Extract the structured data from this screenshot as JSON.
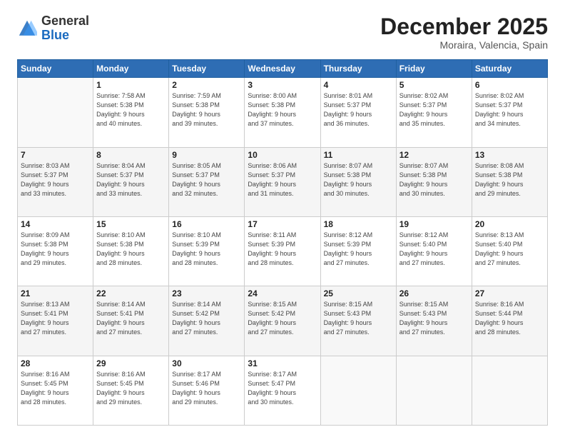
{
  "logo": {
    "general": "General",
    "blue": "Blue"
  },
  "header": {
    "month": "December 2025",
    "location": "Moraira, Valencia, Spain"
  },
  "days_of_week": [
    "Sunday",
    "Monday",
    "Tuesday",
    "Wednesday",
    "Thursday",
    "Friday",
    "Saturday"
  ],
  "weeks": [
    [
      {
        "day": "",
        "info": ""
      },
      {
        "day": "1",
        "info": "Sunrise: 7:58 AM\nSunset: 5:38 PM\nDaylight: 9 hours\nand 40 minutes."
      },
      {
        "day": "2",
        "info": "Sunrise: 7:59 AM\nSunset: 5:38 PM\nDaylight: 9 hours\nand 39 minutes."
      },
      {
        "day": "3",
        "info": "Sunrise: 8:00 AM\nSunset: 5:38 PM\nDaylight: 9 hours\nand 37 minutes."
      },
      {
        "day": "4",
        "info": "Sunrise: 8:01 AM\nSunset: 5:37 PM\nDaylight: 9 hours\nand 36 minutes."
      },
      {
        "day": "5",
        "info": "Sunrise: 8:02 AM\nSunset: 5:37 PM\nDaylight: 9 hours\nand 35 minutes."
      },
      {
        "day": "6",
        "info": "Sunrise: 8:02 AM\nSunset: 5:37 PM\nDaylight: 9 hours\nand 34 minutes."
      }
    ],
    [
      {
        "day": "7",
        "info": "Sunrise: 8:03 AM\nSunset: 5:37 PM\nDaylight: 9 hours\nand 33 minutes."
      },
      {
        "day": "8",
        "info": "Sunrise: 8:04 AM\nSunset: 5:37 PM\nDaylight: 9 hours\nand 33 minutes."
      },
      {
        "day": "9",
        "info": "Sunrise: 8:05 AM\nSunset: 5:37 PM\nDaylight: 9 hours\nand 32 minutes."
      },
      {
        "day": "10",
        "info": "Sunrise: 8:06 AM\nSunset: 5:37 PM\nDaylight: 9 hours\nand 31 minutes."
      },
      {
        "day": "11",
        "info": "Sunrise: 8:07 AM\nSunset: 5:38 PM\nDaylight: 9 hours\nand 30 minutes."
      },
      {
        "day": "12",
        "info": "Sunrise: 8:07 AM\nSunset: 5:38 PM\nDaylight: 9 hours\nand 30 minutes."
      },
      {
        "day": "13",
        "info": "Sunrise: 8:08 AM\nSunset: 5:38 PM\nDaylight: 9 hours\nand 29 minutes."
      }
    ],
    [
      {
        "day": "14",
        "info": "Sunrise: 8:09 AM\nSunset: 5:38 PM\nDaylight: 9 hours\nand 29 minutes."
      },
      {
        "day": "15",
        "info": "Sunrise: 8:10 AM\nSunset: 5:38 PM\nDaylight: 9 hours\nand 28 minutes."
      },
      {
        "day": "16",
        "info": "Sunrise: 8:10 AM\nSunset: 5:39 PM\nDaylight: 9 hours\nand 28 minutes."
      },
      {
        "day": "17",
        "info": "Sunrise: 8:11 AM\nSunset: 5:39 PM\nDaylight: 9 hours\nand 28 minutes."
      },
      {
        "day": "18",
        "info": "Sunrise: 8:12 AM\nSunset: 5:39 PM\nDaylight: 9 hours\nand 27 minutes."
      },
      {
        "day": "19",
        "info": "Sunrise: 8:12 AM\nSunset: 5:40 PM\nDaylight: 9 hours\nand 27 minutes."
      },
      {
        "day": "20",
        "info": "Sunrise: 8:13 AM\nSunset: 5:40 PM\nDaylight: 9 hours\nand 27 minutes."
      }
    ],
    [
      {
        "day": "21",
        "info": "Sunrise: 8:13 AM\nSunset: 5:41 PM\nDaylight: 9 hours\nand 27 minutes."
      },
      {
        "day": "22",
        "info": "Sunrise: 8:14 AM\nSunset: 5:41 PM\nDaylight: 9 hours\nand 27 minutes."
      },
      {
        "day": "23",
        "info": "Sunrise: 8:14 AM\nSunset: 5:42 PM\nDaylight: 9 hours\nand 27 minutes."
      },
      {
        "day": "24",
        "info": "Sunrise: 8:15 AM\nSunset: 5:42 PM\nDaylight: 9 hours\nand 27 minutes."
      },
      {
        "day": "25",
        "info": "Sunrise: 8:15 AM\nSunset: 5:43 PM\nDaylight: 9 hours\nand 27 minutes."
      },
      {
        "day": "26",
        "info": "Sunrise: 8:15 AM\nSunset: 5:43 PM\nDaylight: 9 hours\nand 27 minutes."
      },
      {
        "day": "27",
        "info": "Sunrise: 8:16 AM\nSunset: 5:44 PM\nDaylight: 9 hours\nand 28 minutes."
      }
    ],
    [
      {
        "day": "28",
        "info": "Sunrise: 8:16 AM\nSunset: 5:45 PM\nDaylight: 9 hours\nand 28 minutes."
      },
      {
        "day": "29",
        "info": "Sunrise: 8:16 AM\nSunset: 5:45 PM\nDaylight: 9 hours\nand 29 minutes."
      },
      {
        "day": "30",
        "info": "Sunrise: 8:17 AM\nSunset: 5:46 PM\nDaylight: 9 hours\nand 29 minutes."
      },
      {
        "day": "31",
        "info": "Sunrise: 8:17 AM\nSunset: 5:47 PM\nDaylight: 9 hours\nand 30 minutes."
      },
      {
        "day": "",
        "info": ""
      },
      {
        "day": "",
        "info": ""
      },
      {
        "day": "",
        "info": ""
      }
    ]
  ]
}
